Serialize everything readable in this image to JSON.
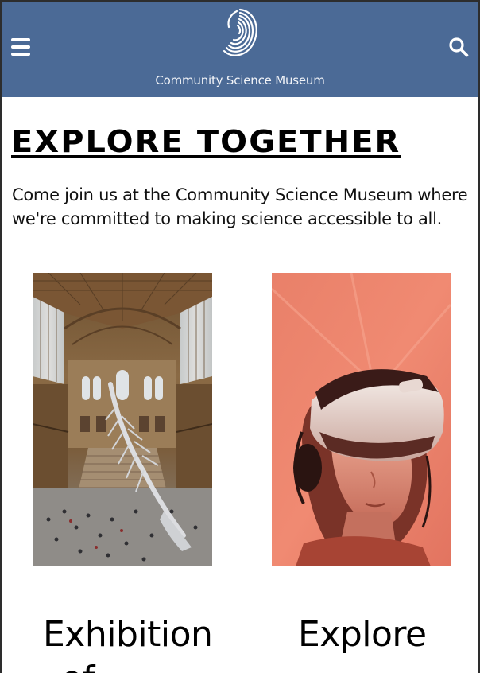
{
  "header": {
    "brand_name": "Community Science Museum",
    "menu_icon": "hamburger-menu-icon",
    "search_icon": "search-icon",
    "background_color": "#4b6a96"
  },
  "hero": {
    "title": "Explore Together",
    "intro": "Come join us at the Community Science Museum where we're committed to making science accessible to all."
  },
  "cards": [
    {
      "title": "Exhibition",
      "title_continued": "of",
      "image": "museum-hall-whale-skeleton-photo"
    },
    {
      "title": "Explore",
      "image": "virtual-reality-headset-photo"
    }
  ]
}
